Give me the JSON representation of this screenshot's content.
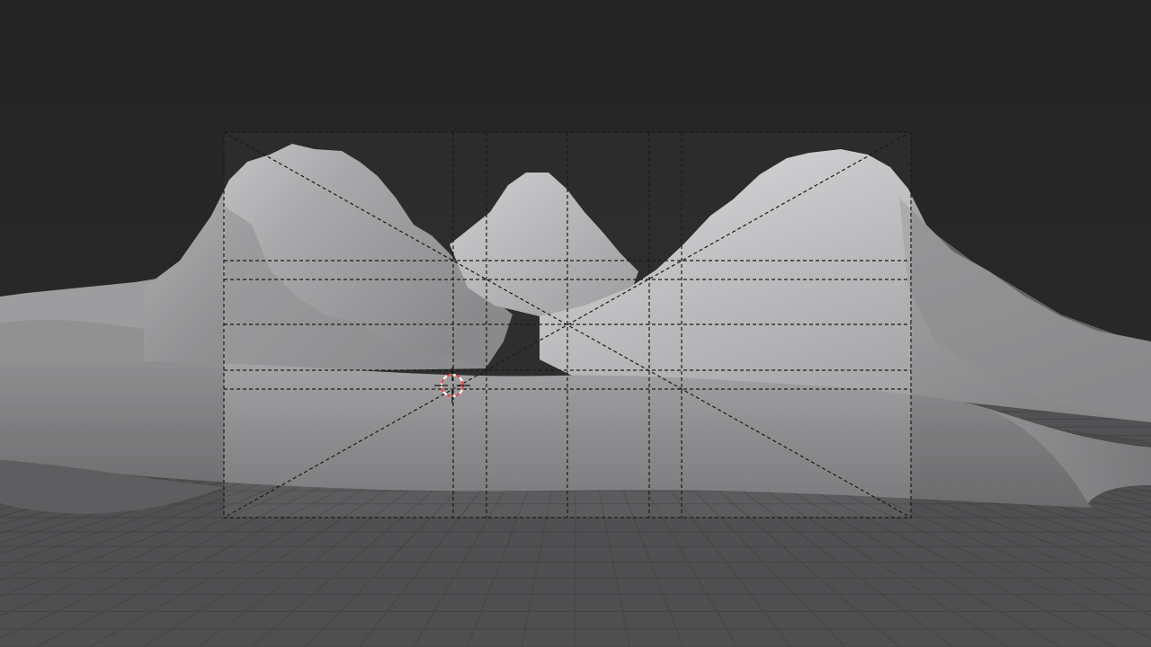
{
  "viewport": {
    "mode": "camera-view",
    "shading": "solid",
    "overlays": {
      "camera_frame": true,
      "composition_guides": [
        "center",
        "diagonal",
        "thirds",
        "golden-ratio"
      ],
      "floor_grid": true,
      "3d_cursor": true
    },
    "scene_objects": [
      "mountain-left",
      "mountain-center",
      "mountain-right",
      "foreground-terrain",
      "floor-grid"
    ]
  },
  "colors": {
    "world_background": "#2a2a2a",
    "terrain_light": "#c9c9cb",
    "terrain_mid": "#9a9a9c",
    "terrain_dark": "#6e6e70",
    "floor": "#555557",
    "guide_lines": "#1a1a1a",
    "cursor_ring": "#e04848"
  }
}
